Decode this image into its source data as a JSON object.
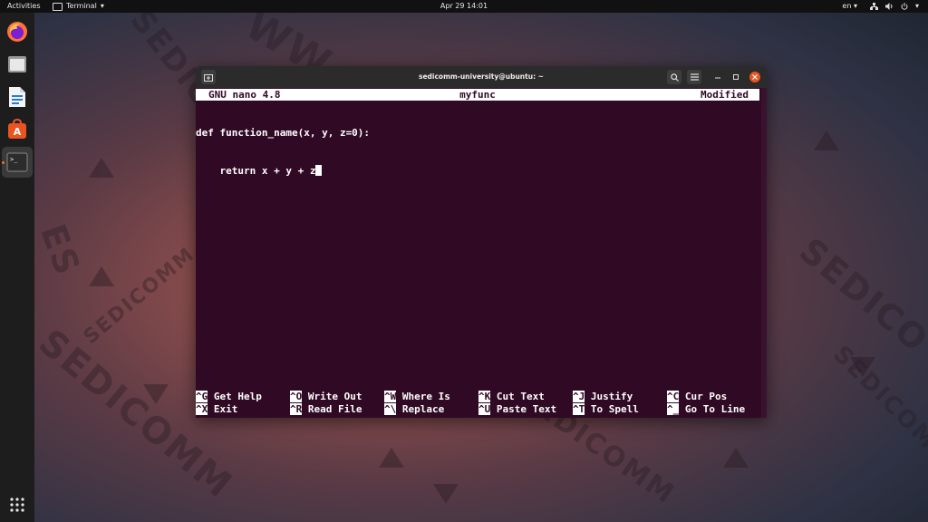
{
  "topbar": {
    "activities": "Activities",
    "app_name": "Terminal",
    "clock": "Apr 29  14:01",
    "lang": "en",
    "lang_arrow": "▾"
  },
  "wallpaper": {
    "brand": "SEDICOMM",
    "brand_mirror": "SEDICOMM",
    "fragments": [
      "SEDICOMM",
      "SEDICOMM",
      "SEDICOMM",
      "SEDICOMM",
      "SEDICO",
      "ES",
      "WW",
      "SEDICOMM"
    ]
  },
  "dock": {
    "items": [
      "firefox-icon",
      "files-icon",
      "writer-icon",
      "software-icon",
      "terminal-icon"
    ],
    "apps_grid": "show-applications-icon"
  },
  "window": {
    "title": "sedicomm-university@ubuntu: ~",
    "nano": {
      "version": "GNU nano 4.8",
      "filename": "myfunc",
      "status": "Modified"
    },
    "code_lines": [
      "def function_name(x, y, z=0):",
      "    return x + y + z"
    ],
    "shortcuts_row1": [
      {
        "key": "^G",
        "label": "Get Help"
      },
      {
        "key": "^O",
        "label": "Write Out"
      },
      {
        "key": "^W",
        "label": "Where Is"
      },
      {
        "key": "^K",
        "label": "Cut Text"
      },
      {
        "key": "^J",
        "label": "Justify"
      },
      {
        "key": "^C",
        "label": "Cur Pos"
      }
    ],
    "shortcuts_row2": [
      {
        "key": "^X",
        "label": "Exit"
      },
      {
        "key": "^R",
        "label": "Read File"
      },
      {
        "key": "^\\",
        "label": "Replace"
      },
      {
        "key": "^U",
        "label": "Paste Text"
      },
      {
        "key": "^T",
        "label": "To Spell"
      },
      {
        "key": "^_",
        "label": "Go To Line"
      }
    ]
  },
  "colors": {
    "terminal_bg": "#300a24",
    "titlebar": "#2b2b2b",
    "close_button": "#e95420",
    "dock_bg": "#1d1d1d"
  }
}
